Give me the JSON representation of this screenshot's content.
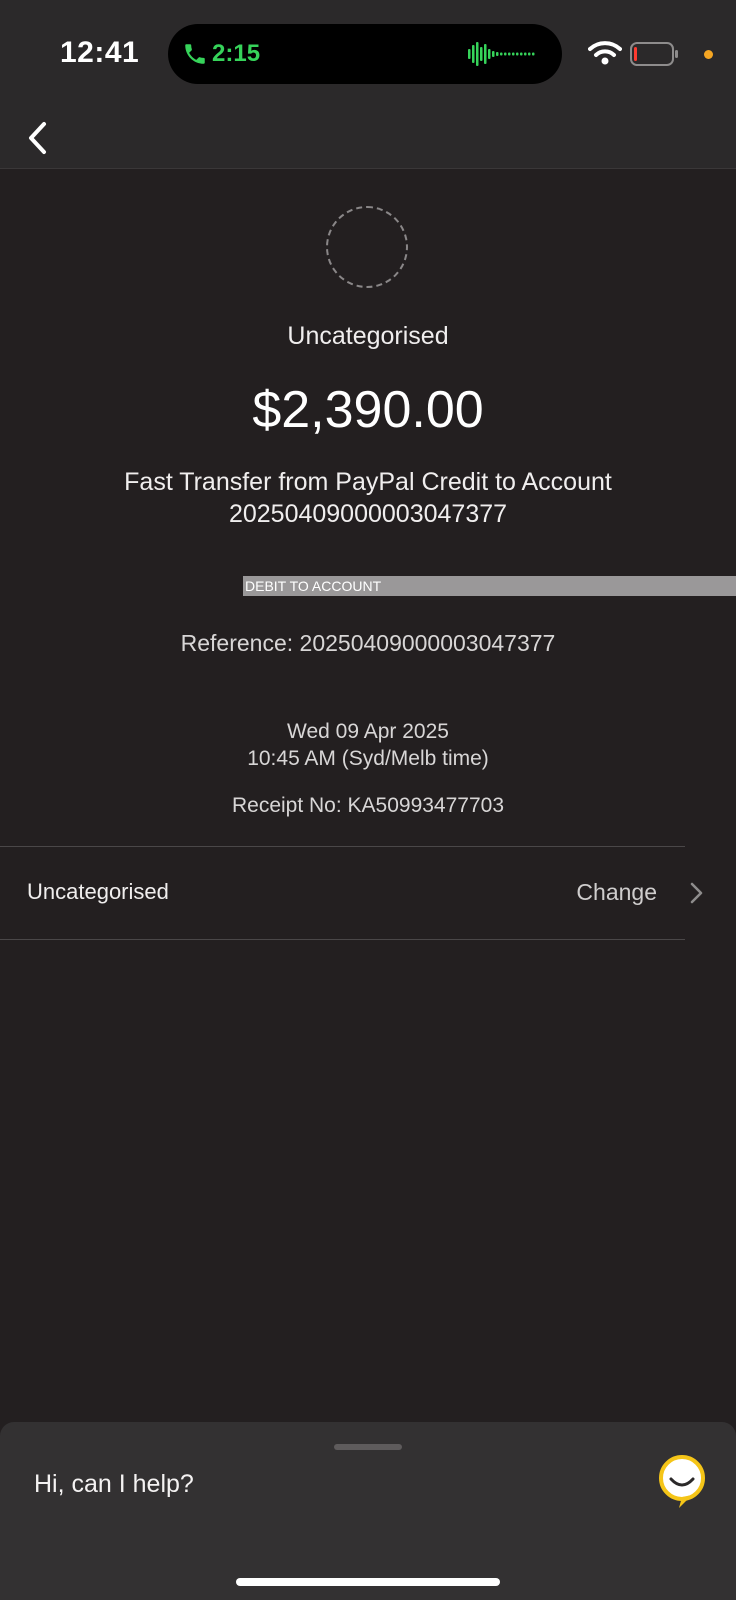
{
  "status_bar": {
    "time": "12:41",
    "call_duration": "2:15",
    "icons": [
      "phone-icon",
      "waveform-icon",
      "wifi-icon",
      "battery-icon"
    ],
    "call_color": "#36d35a",
    "privacy_dot_color": "#f5a623"
  },
  "nav": {
    "back_icon": "chevron-left-icon"
  },
  "transaction": {
    "category": "Uncategorised",
    "amount": "$2,390.00",
    "description": "Fast Transfer from PayPal Credit to Account 20250409000003047377",
    "type_label": "DEBIT TO ACCOUNT",
    "reference": "Reference: 20250409000003047377",
    "date": "Wed 09 Apr 2025",
    "time": "10:45 AM (Syd/Melb time)",
    "receipt": "Receipt No: KA50993477703"
  },
  "category_row": {
    "label": "Uncategorised",
    "action": "Change"
  },
  "help": {
    "prompt": "Hi, can I help?",
    "icon": "assistant-smile-icon",
    "accent": "#f5c518"
  },
  "colors": {
    "background": "#231f20",
    "header": "#2b292a",
    "sheet": "#333132"
  }
}
